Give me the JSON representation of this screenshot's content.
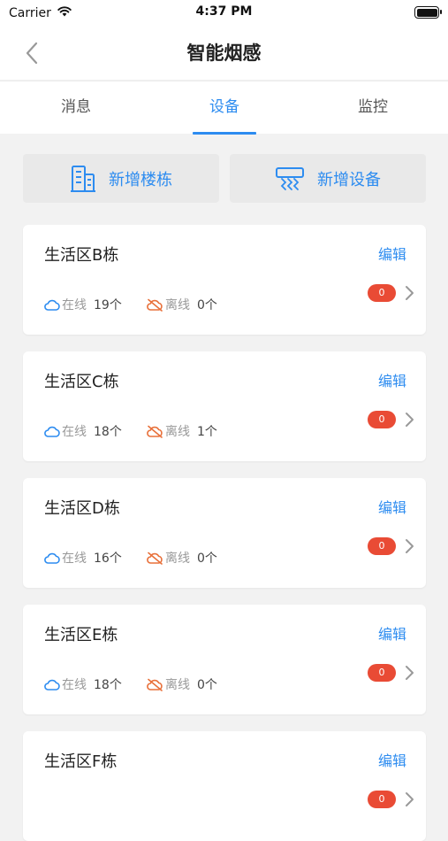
{
  "status_bar": {
    "carrier": "Carrier",
    "time": "4:37 PM"
  },
  "nav": {
    "title": "智能烟感"
  },
  "tabs": [
    {
      "label": "消息",
      "active": false
    },
    {
      "label": "设备",
      "active": true
    },
    {
      "label": "监控",
      "active": false
    }
  ],
  "actions": {
    "add_building": "新增楼栋",
    "add_device": "新增设备"
  },
  "cards": [
    {
      "name": "生活区B栋",
      "edit": "编辑",
      "online_label": "在线",
      "online_count": "19个",
      "offline_label": "离线",
      "offline_count": "0个",
      "badge": "0"
    },
    {
      "name": "生活区C栋",
      "edit": "编辑",
      "online_label": "在线",
      "online_count": "18个",
      "offline_label": "离线",
      "offline_count": "1个",
      "badge": "0"
    },
    {
      "name": "生活区D栋",
      "edit": "编辑",
      "online_label": "在线",
      "online_count": "16个",
      "offline_label": "离线",
      "offline_count": "0个",
      "badge": "0"
    },
    {
      "name": "生活区E栋",
      "edit": "编辑",
      "online_label": "在线",
      "online_count": "18个",
      "offline_label": "离线",
      "offline_count": "0个",
      "badge": "0"
    },
    {
      "name": "生活区F栋",
      "edit": "编辑",
      "badge": "0"
    }
  ],
  "colors": {
    "accent": "#2d8cf0",
    "offline": "#e8703a",
    "badge": "#e94b35",
    "background": "#f2f2f2"
  },
  "icons": [
    "wifi-icon",
    "battery-icon",
    "back-chevron-icon",
    "building-icon",
    "smoke-detector-icon",
    "cloud-online-icon",
    "cloud-offline-icon",
    "chevron-right-icon"
  ]
}
